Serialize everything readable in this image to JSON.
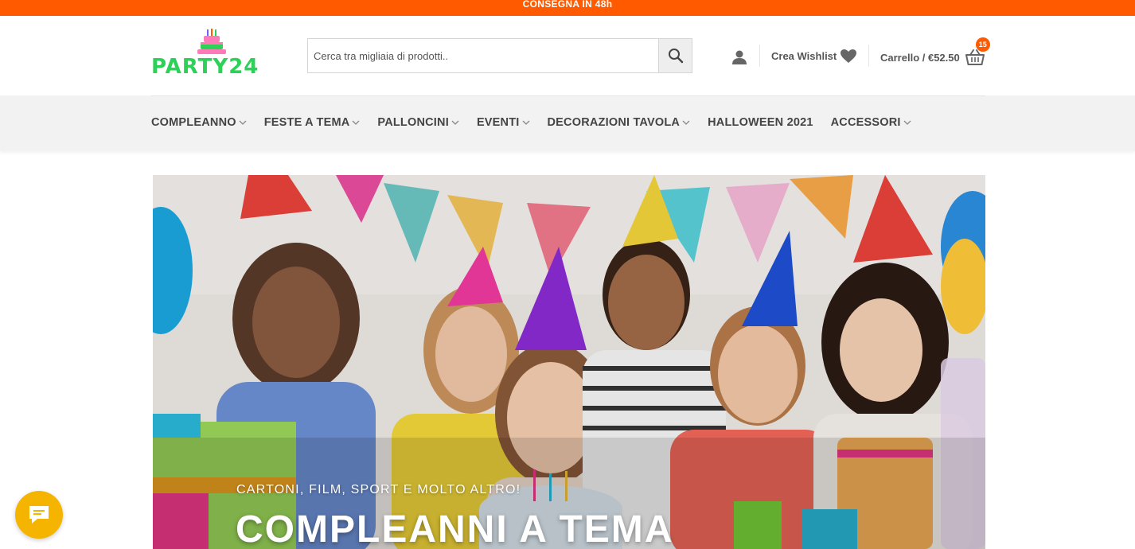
{
  "topbar": {
    "text": "CONSEGNA IN 48h"
  },
  "brand": {
    "name": "PARTY24",
    "accent": "#ff5a00",
    "green": "#2ed158"
  },
  "search": {
    "placeholder": "Cerca tra migliaia di prodotti..",
    "value": "",
    "icon": "search-icon"
  },
  "account": {
    "icon": "user-icon"
  },
  "wishlist": {
    "label": "Crea Wishlist",
    "icon": "heart-icon"
  },
  "cart": {
    "label": "Carrello / €52.50",
    "count": "15",
    "icon": "basket-icon"
  },
  "nav": {
    "items": [
      {
        "label": "COMPLEANNO",
        "has_dropdown": true
      },
      {
        "label": "FESTE A TEMA",
        "has_dropdown": true
      },
      {
        "label": "PALLONCINI",
        "has_dropdown": true
      },
      {
        "label": "EVENTI",
        "has_dropdown": true
      },
      {
        "label": "DECORAZIONI TAVOLA",
        "has_dropdown": true
      },
      {
        "label": "HALLOWEEN 2021",
        "has_dropdown": false
      },
      {
        "label": "ACCESSORI",
        "has_dropdown": true
      }
    ]
  },
  "hero": {
    "subtitle": "CARTONI, FILM, SPORT E MOLTO ALTRO!",
    "title": "COMPLEANNI A TEMA"
  },
  "chat": {
    "icon": "chat-icon"
  }
}
